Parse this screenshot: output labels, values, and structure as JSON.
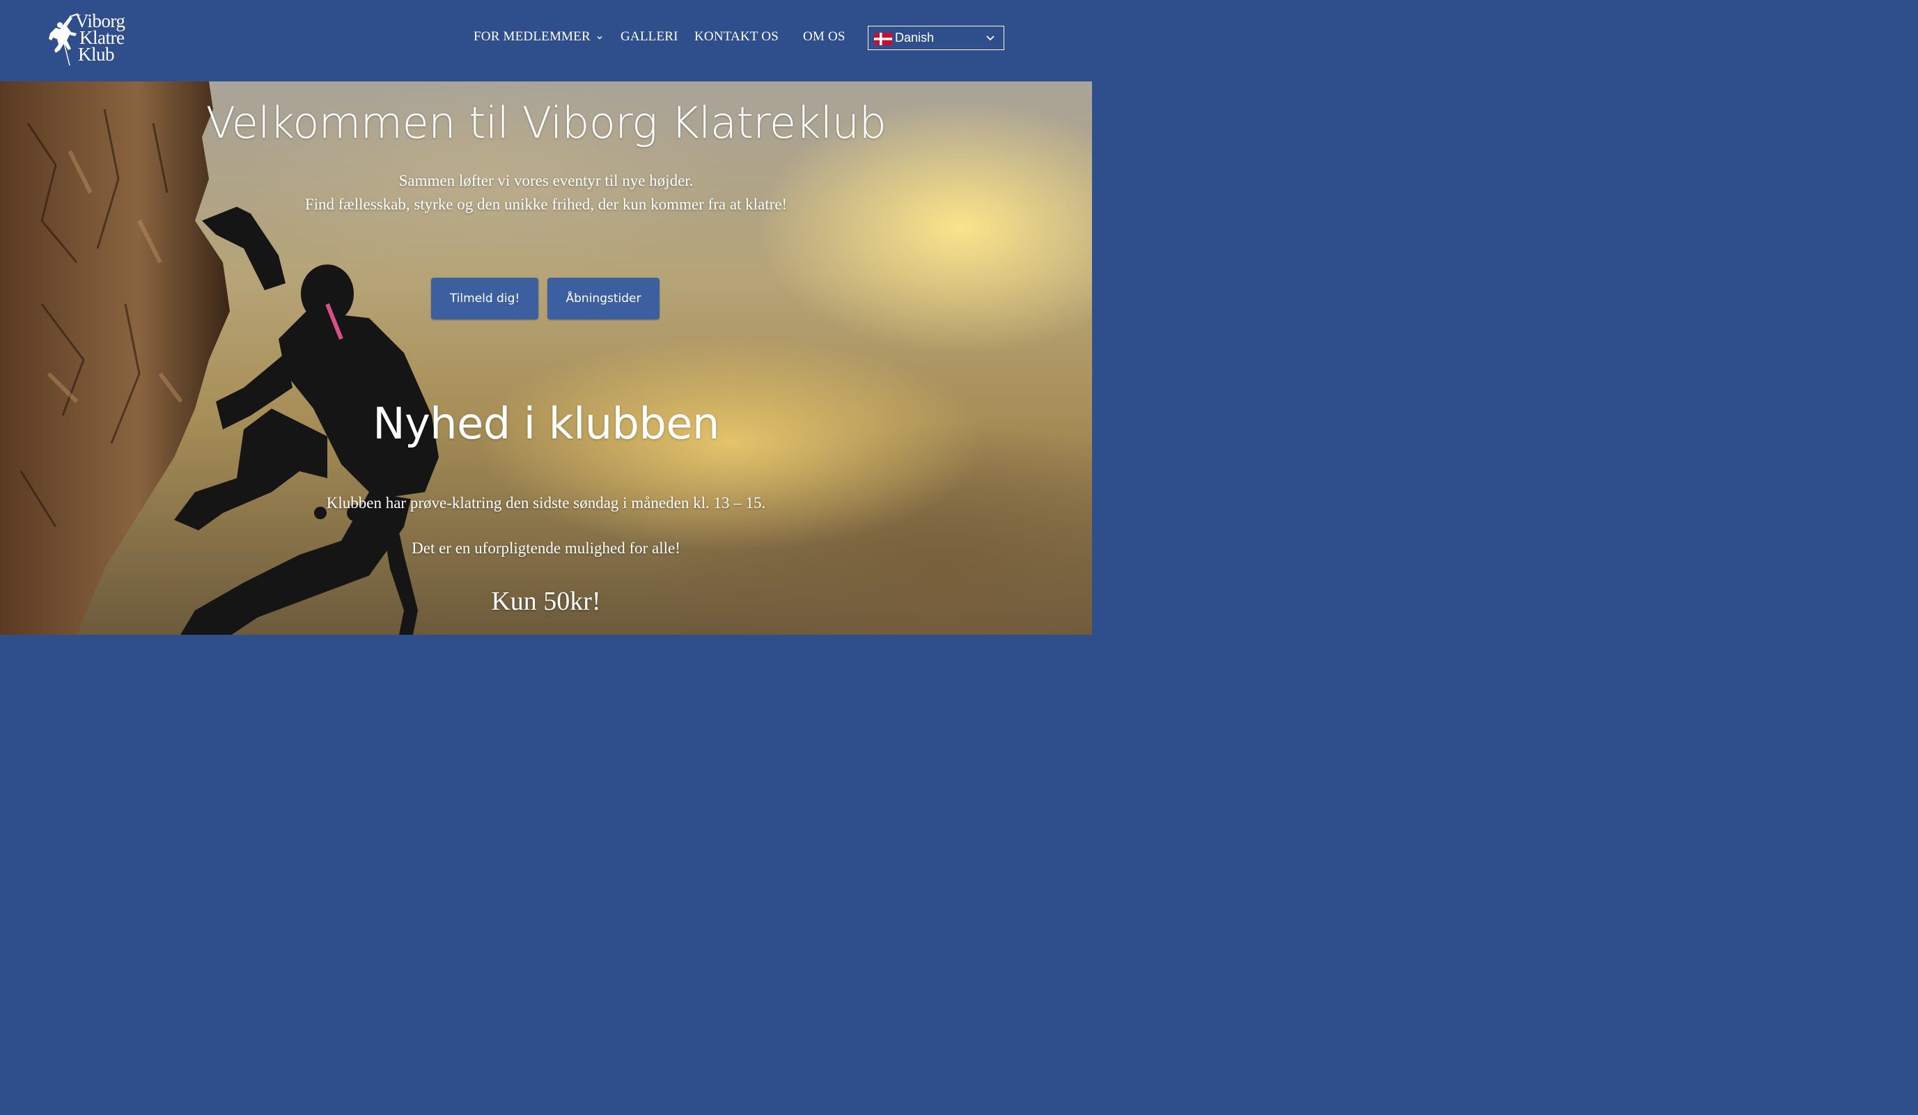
{
  "header": {
    "logo": {
      "line1": "Viborg",
      "line2": "Klatre",
      "line3": "Klub"
    },
    "nav": [
      {
        "label": "FOR MEDLEMMER",
        "has_dropdown": true
      },
      {
        "label": "GALLERI"
      },
      {
        "label": "KONTAKT OS"
      },
      {
        "label": "OM OS"
      }
    ],
    "language": {
      "selected": "Danish",
      "flag": "denmark-flag-icon"
    }
  },
  "hero": {
    "title": "Velkommen til Viborg Klatreklub",
    "subtitle_line1": "Sammen løfter vi vores eventyr til nye højder.",
    "subtitle_line2": "Find fællesskab, styrke og den unikke frihed, der kun kommer fra at klatre!",
    "buttons": {
      "signup": "Tilmeld dig!",
      "hours": "Åbningstider"
    }
  },
  "news": {
    "title": "Nyhed i klubben",
    "paragraph1": "Klubben har prøve-klatring den sidste søndag i måneden kl. 13 – 15.",
    "paragraph2": "Det er en uforpligtende mulighed for alle!",
    "price": "Kun 50kr!"
  },
  "colors": {
    "header_bg": "#2e4f8b",
    "button_bg": "#3c5f9f",
    "text": "#ffffff"
  }
}
